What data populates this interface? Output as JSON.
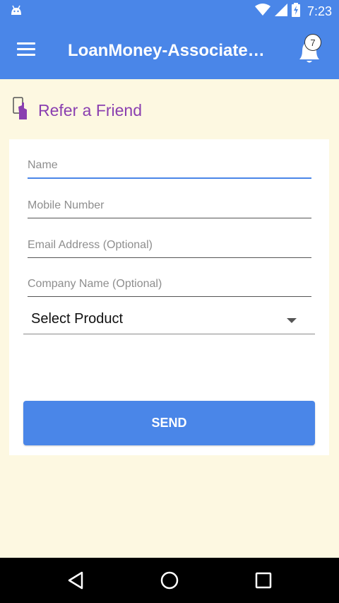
{
  "status_bar": {
    "time": "7:23",
    "icons": [
      "android-icon",
      "wifi-icon",
      "signal-icon",
      "battery-charging-icon"
    ]
  },
  "app_bar": {
    "title": "LoanMoney-Associate…",
    "notification_count": "7",
    "color": "#4a86e8"
  },
  "refer": {
    "heading": "Refer a Friend",
    "heading_color": "#8a3fb0",
    "icon": "phone-hand-icon"
  },
  "form": {
    "name_placeholder": "Name",
    "mobile_placeholder": "Mobile Number",
    "email_placeholder": "Email Address (Optional)",
    "company_placeholder": "Company Name (Optional)",
    "product_selected": "Select Product",
    "send_label": "SEND"
  },
  "nav_bar": {
    "buttons": [
      "back-icon",
      "home-icon",
      "recents-icon"
    ]
  }
}
